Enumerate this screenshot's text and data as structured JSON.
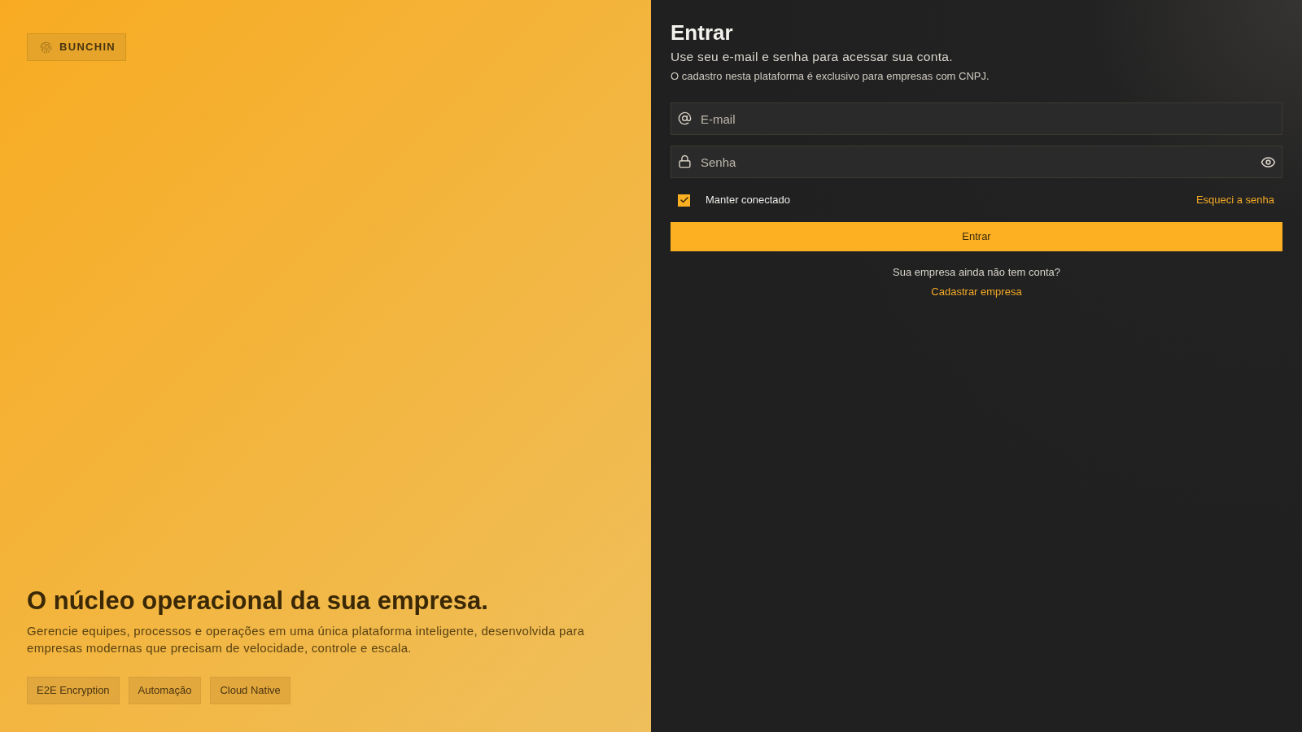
{
  "brand": {
    "name": "BUNCHIN"
  },
  "hero": {
    "headline": "O núcleo operacional da sua empresa.",
    "description": "Gerencie equipes, processos e operações em uma única plataforma inteligente, desenvolvida para empresas modernas que precisam de velocidade, controle e escala.",
    "tags": [
      "E2E Encryption",
      "Automação",
      "Cloud Native"
    ]
  },
  "login": {
    "title": "Entrar",
    "subtitle": "Use seu e-mail e senha para acessar sua conta.",
    "note": "O cadastro nesta plataforma é exclusivo para empresas com CNPJ.",
    "fields": [
      {
        "kind": "email",
        "placeholder": "E-mail"
      },
      {
        "kind": "password",
        "placeholder": "Senha"
      }
    ],
    "remember": {
      "label": "Manter conectado",
      "checked": true
    },
    "forgot_link": "Esqueci a senha",
    "submit": "Entrar",
    "signup_prompt": "Sua empresa ainda não tem conta?",
    "signup_link": "Cadastrar empresa"
  }
}
